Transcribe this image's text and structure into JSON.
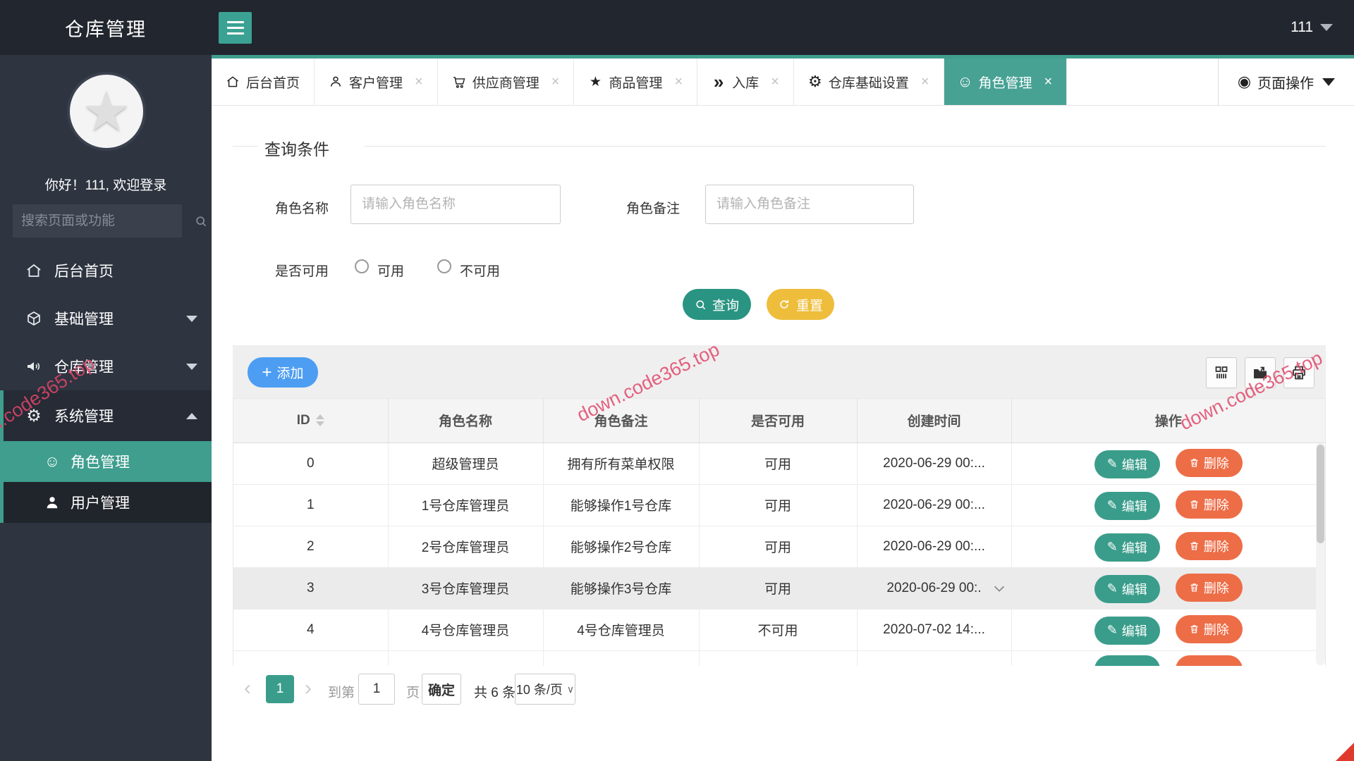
{
  "header": {
    "title": "仓库管理",
    "username": "111"
  },
  "sidebar": {
    "greeting": "你好！111, 欢迎登录",
    "search_placeholder": "搜索页面或功能",
    "items": [
      {
        "label": "后台首页",
        "icon": "home"
      },
      {
        "label": "基础管理",
        "icon": "cube",
        "arrow": "down"
      },
      {
        "label": "仓库管理",
        "icon": "speaker",
        "arrow": "down"
      },
      {
        "label": "系统管理",
        "icon": "gear",
        "arrow": "up",
        "active": true
      }
    ],
    "subitems": [
      {
        "label": "角色管理",
        "icon": "smiley",
        "active": true
      },
      {
        "label": "用户管理",
        "icon": "user"
      }
    ]
  },
  "tabs": [
    {
      "label": "后台首页",
      "icon": "home",
      "closable": false
    },
    {
      "label": "客户管理",
      "icon": "person",
      "closable": true
    },
    {
      "label": "供应商管理",
      "icon": "cart",
      "closable": true
    },
    {
      "label": "商品管理",
      "icon": "star",
      "closable": true
    },
    {
      "label": "入库",
      "icon": "double-chevron",
      "closable": true
    },
    {
      "label": "仓库基础设置",
      "icon": "gear",
      "closable": true
    },
    {
      "label": "角色管理",
      "icon": "smiley",
      "closable": true,
      "active": true
    }
  ],
  "page_ops": {
    "label": "页面操作",
    "icon": "record"
  },
  "query": {
    "legend": "查询条件",
    "fields": [
      {
        "label": "角色名称",
        "placeholder": "请输入角色名称"
      },
      {
        "label": "角色备注",
        "placeholder": "请输入角色备注"
      }
    ],
    "radio_label": "是否可用",
    "radio_options": [
      "可用",
      "不可用"
    ],
    "search_label": "查询",
    "reset_label": "重置"
  },
  "toolbar": {
    "add_label": "添加"
  },
  "table": {
    "columns": [
      "ID",
      "角色名称",
      "角色备注",
      "是否可用",
      "创建时间",
      "操作"
    ],
    "edit_label": "编辑",
    "delete_label": "删除",
    "rows": [
      {
        "id": "0",
        "name": "超级管理员",
        "remark": "拥有所有菜单权限",
        "enabled": "可用",
        "time": "2020-06-29 00:..."
      },
      {
        "id": "1",
        "name": "1号仓库管理员",
        "remark": "能够操作1号仓库",
        "enabled": "可用",
        "time": "2020-06-29 00:..."
      },
      {
        "id": "2",
        "name": "2号仓库管理员",
        "remark": "能够操作2号仓库",
        "enabled": "可用",
        "time": "2020-06-29 00:..."
      },
      {
        "id": "3",
        "name": "3号仓库管理员",
        "remark": "能够操作3号仓库",
        "enabled": "可用",
        "time": "2020-06-29 00:."
      },
      {
        "id": "4",
        "name": "4号仓库管理员",
        "remark": "4号仓库管理员",
        "enabled": "不可用",
        "time": "2020-07-02 14:..."
      }
    ]
  },
  "pagination": {
    "current_page": "1",
    "goto_label": "到第",
    "goto_value": "1",
    "page_word": "页",
    "confirm_label": "确定",
    "total_label": "共 6 条",
    "page_size_label": "10 条/页"
  },
  "watermark": {
    "text": "down.code365.top"
  },
  "glyphs": {
    "star": "★",
    "double_chevron": "»",
    "gear": "⚙",
    "smiley": "☺",
    "record": "◉",
    "close": "×",
    "pencil": "✎",
    "plus": "+",
    "avatar_star": "★",
    "prev": "‹",
    "next": "›",
    "select_caret": "∨"
  },
  "colors": {
    "theme_teal": "#3f9e8e",
    "add_blue": "#4d9ef2",
    "reset_yellow": "#eebd3b",
    "delete_orange": "#ed6d47",
    "enabled_blue": "#2436c8",
    "disabled_red": "#e0452f"
  }
}
